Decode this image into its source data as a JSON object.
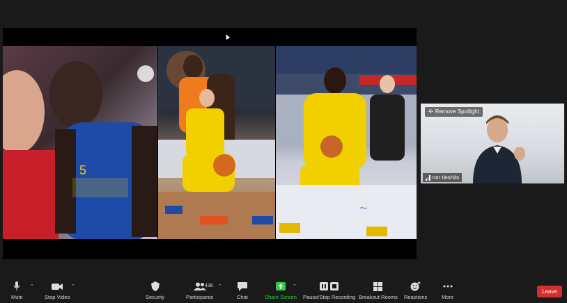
{
  "meeting": {
    "participant_count": "436",
    "spotlight_label": "Remove Spotlight",
    "speaker_name": "ron tieshits"
  },
  "toolbar": {
    "mute": "Mute",
    "stop_video": "Stop Video",
    "security": "Security",
    "participants": "Participants",
    "chat": "Chat",
    "share_screen": "Share Screen",
    "recording": "Pause/Stop Recording",
    "breakout": "Breakout Rooms",
    "reactions": "Reactions",
    "more": "More",
    "leave": "Leave"
  },
  "colors": {
    "share_green": "#2ecc40",
    "leave_red": "#d32f2f",
    "team_yellow": "#f2d000",
    "team_blue": "#1e4aa8",
    "team_orange": "#f07a1e"
  }
}
